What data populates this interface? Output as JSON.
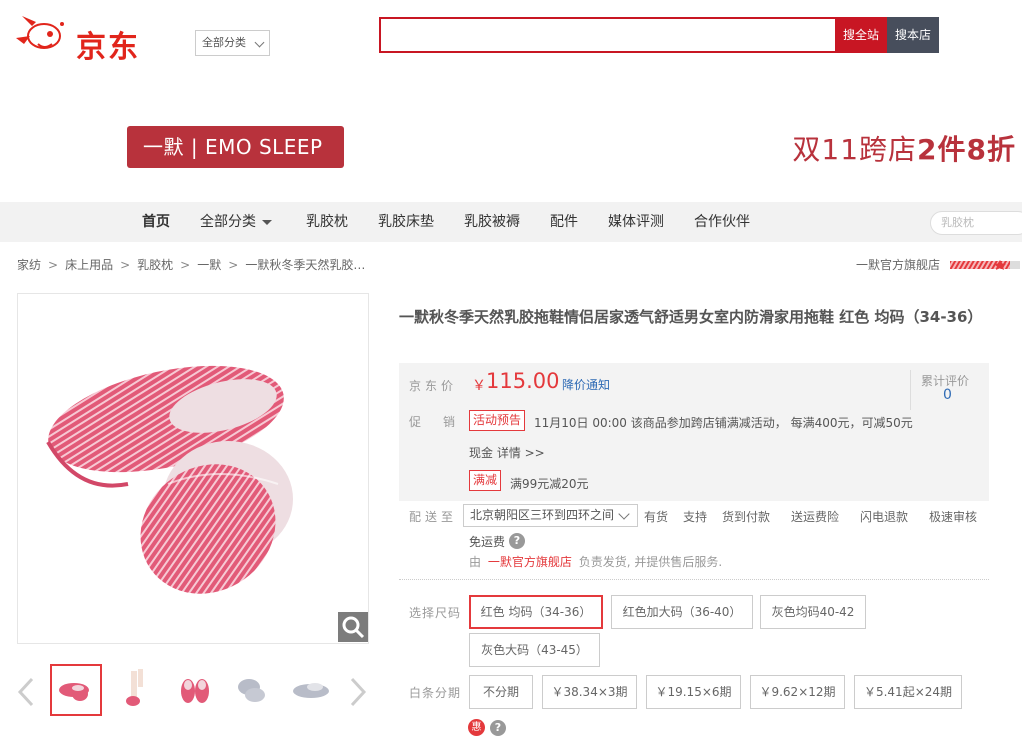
{
  "header": {
    "logo_text": "京东",
    "category_select": "全部分类",
    "search_placeholder": "",
    "search_all_label": "搜全站",
    "search_store_label": "搜本店"
  },
  "shop_banner": {
    "brand_text": "一默 | EMO SLEEP",
    "promo_prefix": "双11跨店",
    "promo_bold": "2件8折"
  },
  "nav": {
    "items": [
      {
        "label": "首页"
      },
      {
        "label": "全部分类"
      },
      {
        "label": "乳胶枕"
      },
      {
        "label": "乳胶床垫"
      },
      {
        "label": "乳胶被褥"
      },
      {
        "label": "配件"
      },
      {
        "label": "媒体评测"
      },
      {
        "label": "合作伙伴"
      }
    ],
    "search_placeholder": "乳胶枕"
  },
  "breadcrumb": {
    "items": [
      "家纺",
      "床上用品",
      "乳胶枕",
      "一默",
      "一默秋冬季天然乳胶…"
    ],
    "separator": ">",
    "store_name": "一默官方旗舰店"
  },
  "product": {
    "title": "一默秋冬季天然乳胶拖鞋情侣居家透气舒适男女室内防滑家用拖鞋 红色 均码（34-36）",
    "price_label": "京东价",
    "currency": "￥",
    "price": "115.00",
    "price_alert": "降价通知",
    "review_label": "累计评价",
    "review_count": "0",
    "promo_label": "促销",
    "promo_tag1": "活动预告",
    "promo_text1": "11月10日 00:00 该商品参加跨店铺满减活动， 每满400元，可减50元",
    "promo_text1b": "现金 详情 >>",
    "promo_tag2": "满减",
    "promo_text2": "满99元减20元",
    "delivery_label": "配送至",
    "address": "北京朝阳区三环到四环之间",
    "services": [
      "有货",
      "支持",
      "货到付款",
      "送运费险",
      "闪电退款",
      "极速审核"
    ],
    "free_shipping": "免运费",
    "seller_prefix": "由",
    "seller_name": "一默官方旗舰店",
    "seller_suffix": "负责发货, 并提供售后服务.",
    "size_label": "选择尺码",
    "sizes": [
      "红色 均码（34-36）",
      "红色加大码（36-40）",
      "灰色均码40-42",
      "灰色大码（43-45）"
    ],
    "installment_label": "白条分期",
    "installments": [
      "不分期",
      "￥38.34×3期",
      "￥19.15×6期",
      "￥9.62×12期",
      "￥5.41起×24期"
    ],
    "hui_icon": "惠"
  },
  "colors": {
    "brand_red": "#e1251b",
    "accent_red": "#c81623",
    "badge_red": "#b8323c",
    "link_blue": "#2f6bb5",
    "nav_bg": "#f2f2f2"
  }
}
